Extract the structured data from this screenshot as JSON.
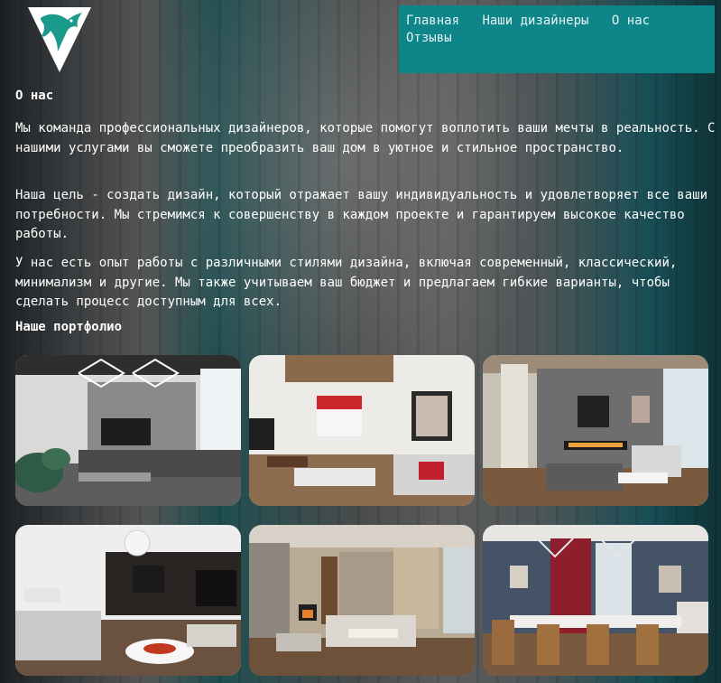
{
  "nav": {
    "items": [
      "Главная",
      "Наши дизайнеры",
      "О нас",
      "Отзывы"
    ]
  },
  "about": {
    "title": "О нас",
    "paragraphs": [
      "Мы команда профессиональных дизайнеров, которые помогут воплотить ваши мечты в реальность. С нашими услугами вы сможете преобразить ваш дом в уютное и стильное пространство.",
      "Наша цель - создать дизайн, который отражает вашу индивидуальность и удовлетворяет все ваши потребности. Мы стремимся к совершенству в каждом проекте и гарантируем высокое качество работы.",
      "У нас есть опыт работы с различными стилями дизайна, включая современный, классический, минимализм и другие. Мы также учитываем ваш бюджет и предлагаем гибкие варианты, чтобы сделать процесс доступным для всех."
    ]
  },
  "portfolio": {
    "title": "Наше портфолио"
  },
  "colors": {
    "nav_background": "#0e8589",
    "logo_accent": "#1a9a8c"
  },
  "icons": {
    "logo": "phoenix-logo-icon"
  }
}
